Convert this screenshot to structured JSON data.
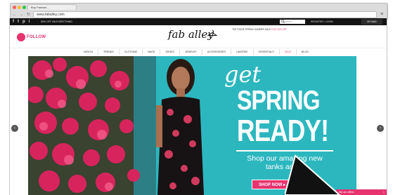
{
  "browser": {
    "tab_title": "Buy Fashion...",
    "url": "www.faballey.com",
    "nav_back": "←",
    "nav_forward": "→",
    "nav_reload": "↻",
    "menu": "≡"
  },
  "topbar": {
    "social": [
      "f",
      "t",
      "p",
      "i"
    ],
    "promo_text": "50% OFF ON EVERYTHING",
    "search_placeholder": "Search",
    "account_links": "REGISTER / LOGIN",
    "bag_label": "MY BAG"
  },
  "header": {
    "badge_text": "FOLLOW",
    "logo_text": "fab alley",
    "spring_note": "THE STAGE SPRING SUMMER SALE",
    "spring_note_highlight": "FLAT 30% OFF"
  },
  "categories": [
    "NEW IN",
    "TRENDS",
    "CLOTHING",
    "BAGS",
    "SHOES",
    "JEWELRY",
    "ACCESSORIES",
    "LINGERIE",
    "ESSENTIALS",
    "SALE",
    "BLOG"
  ],
  "hero": {
    "headline_script": "get",
    "headline_line1": "SPRING",
    "headline_line2": "READY!",
    "subline1": "Shop our amazing new",
    "subline2": "tanks and o",
    "cta_label": "SHOP NOW ▸"
  },
  "carousel": {
    "prev": "‹",
    "next": "›"
  },
  "chat": {
    "label": "We are offline",
    "close": "×"
  },
  "colors": {
    "brand_pink": "#e8336e",
    "hero_teal": "#2cb7bf",
    "topbar": "#141414"
  }
}
